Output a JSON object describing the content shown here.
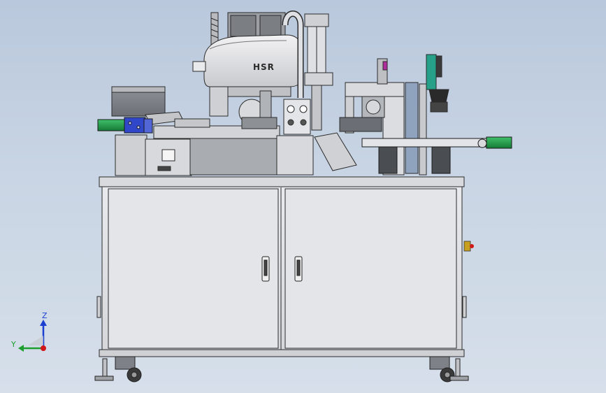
{
  "model": {
    "robot_brand": "HSR"
  },
  "triad": {
    "z_label": "Z",
    "y_label": "Y",
    "colors": {
      "z": "#1a3fd1",
      "y": "#1e9e2e",
      "x": "#d01818"
    }
  },
  "palette": {
    "frame": "#e6e7ea",
    "panel": "#dcdde1",
    "line": "#2b2b2b",
    "green": "#1f8f47",
    "blue": "#2f47c8",
    "steel": "#9aa6b3",
    "bg_top": "#b9c8dc"
  }
}
